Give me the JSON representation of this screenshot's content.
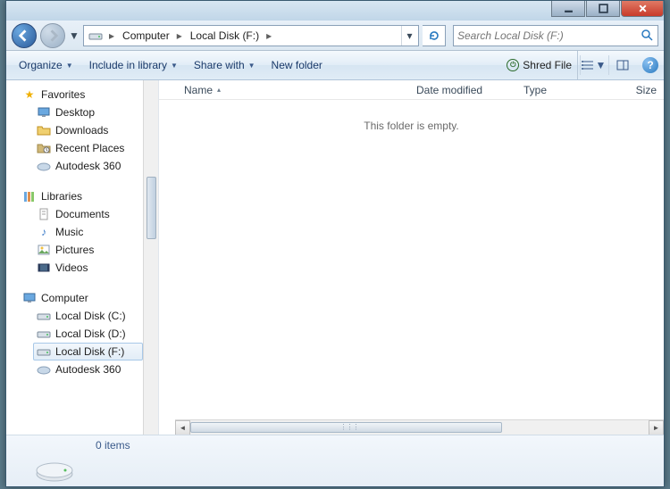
{
  "titlebar": {},
  "nav": {
    "crumb1": "Computer",
    "crumb2": "Local Disk (F:)",
    "search_placeholder": "Search Local Disk (F:)"
  },
  "toolbar": {
    "organize": "Organize",
    "include": "Include in library",
    "share": "Share with",
    "newfolder": "New folder",
    "shred": "Shred File"
  },
  "columns": {
    "name": "Name",
    "date": "Date modified",
    "type": "Type",
    "size": "Size"
  },
  "empty_msg": "This folder is empty.",
  "navpane": {
    "favorites": {
      "label": "Favorites",
      "items": [
        "Desktop",
        "Downloads",
        "Recent Places",
        "Autodesk 360"
      ]
    },
    "libraries": {
      "label": "Libraries",
      "items": [
        "Documents",
        "Music",
        "Pictures",
        "Videos"
      ]
    },
    "computer": {
      "label": "Computer",
      "items": [
        "Local Disk (C:)",
        "Local Disk (D:)",
        "Local Disk (F:)",
        "Autodesk 360"
      ]
    }
  },
  "status": {
    "items": "0 items"
  }
}
